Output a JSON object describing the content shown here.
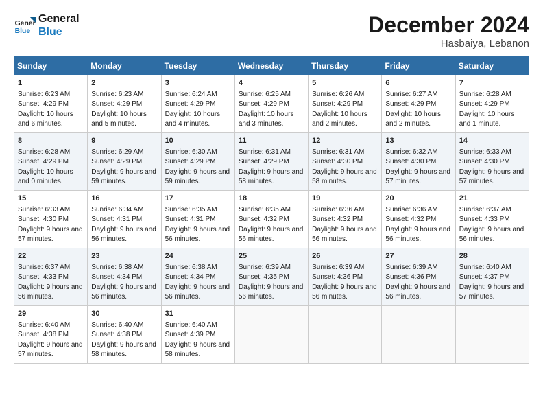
{
  "logo": {
    "line1": "General",
    "line2": "Blue"
  },
  "title": "December 2024",
  "subtitle": "Hasbaiya, Lebanon",
  "days_header": [
    "Sunday",
    "Monday",
    "Tuesday",
    "Wednesday",
    "Thursday",
    "Friday",
    "Saturday"
  ],
  "weeks": [
    [
      {
        "day": "1",
        "sunrise": "6:23 AM",
        "sunset": "4:29 PM",
        "daylight": "10 hours and 6 minutes."
      },
      {
        "day": "2",
        "sunrise": "6:23 AM",
        "sunset": "4:29 PM",
        "daylight": "10 hours and 5 minutes."
      },
      {
        "day": "3",
        "sunrise": "6:24 AM",
        "sunset": "4:29 PM",
        "daylight": "10 hours and 4 minutes."
      },
      {
        "day": "4",
        "sunrise": "6:25 AM",
        "sunset": "4:29 PM",
        "daylight": "10 hours and 3 minutes."
      },
      {
        "day": "5",
        "sunrise": "6:26 AM",
        "sunset": "4:29 PM",
        "daylight": "10 hours and 2 minutes."
      },
      {
        "day": "6",
        "sunrise": "6:27 AM",
        "sunset": "4:29 PM",
        "daylight": "10 hours and 2 minutes."
      },
      {
        "day": "7",
        "sunrise": "6:28 AM",
        "sunset": "4:29 PM",
        "daylight": "10 hours and 1 minute."
      }
    ],
    [
      {
        "day": "8",
        "sunrise": "6:28 AM",
        "sunset": "4:29 PM",
        "daylight": "10 hours and 0 minutes."
      },
      {
        "day": "9",
        "sunrise": "6:29 AM",
        "sunset": "4:29 PM",
        "daylight": "9 hours and 59 minutes."
      },
      {
        "day": "10",
        "sunrise": "6:30 AM",
        "sunset": "4:29 PM",
        "daylight": "9 hours and 59 minutes."
      },
      {
        "day": "11",
        "sunrise": "6:31 AM",
        "sunset": "4:29 PM",
        "daylight": "9 hours and 58 minutes."
      },
      {
        "day": "12",
        "sunrise": "6:31 AM",
        "sunset": "4:30 PM",
        "daylight": "9 hours and 58 minutes."
      },
      {
        "day": "13",
        "sunrise": "6:32 AM",
        "sunset": "4:30 PM",
        "daylight": "9 hours and 57 minutes."
      },
      {
        "day": "14",
        "sunrise": "6:33 AM",
        "sunset": "4:30 PM",
        "daylight": "9 hours and 57 minutes."
      }
    ],
    [
      {
        "day": "15",
        "sunrise": "6:33 AM",
        "sunset": "4:30 PM",
        "daylight": "9 hours and 57 minutes."
      },
      {
        "day": "16",
        "sunrise": "6:34 AM",
        "sunset": "4:31 PM",
        "daylight": "9 hours and 56 minutes."
      },
      {
        "day": "17",
        "sunrise": "6:35 AM",
        "sunset": "4:31 PM",
        "daylight": "9 hours and 56 minutes."
      },
      {
        "day": "18",
        "sunrise": "6:35 AM",
        "sunset": "4:32 PM",
        "daylight": "9 hours and 56 minutes."
      },
      {
        "day": "19",
        "sunrise": "6:36 AM",
        "sunset": "4:32 PM",
        "daylight": "9 hours and 56 minutes."
      },
      {
        "day": "20",
        "sunrise": "6:36 AM",
        "sunset": "4:32 PM",
        "daylight": "9 hours and 56 minutes."
      },
      {
        "day": "21",
        "sunrise": "6:37 AM",
        "sunset": "4:33 PM",
        "daylight": "9 hours and 56 minutes."
      }
    ],
    [
      {
        "day": "22",
        "sunrise": "6:37 AM",
        "sunset": "4:33 PM",
        "daylight": "9 hours and 56 minutes."
      },
      {
        "day": "23",
        "sunrise": "6:38 AM",
        "sunset": "4:34 PM",
        "daylight": "9 hours and 56 minutes."
      },
      {
        "day": "24",
        "sunrise": "6:38 AM",
        "sunset": "4:34 PM",
        "daylight": "9 hours and 56 minutes."
      },
      {
        "day": "25",
        "sunrise": "6:39 AM",
        "sunset": "4:35 PM",
        "daylight": "9 hours and 56 minutes."
      },
      {
        "day": "26",
        "sunrise": "6:39 AM",
        "sunset": "4:36 PM",
        "daylight": "9 hours and 56 minutes."
      },
      {
        "day": "27",
        "sunrise": "6:39 AM",
        "sunset": "4:36 PM",
        "daylight": "9 hours and 56 minutes."
      },
      {
        "day": "28",
        "sunrise": "6:40 AM",
        "sunset": "4:37 PM",
        "daylight": "9 hours and 57 minutes."
      }
    ],
    [
      {
        "day": "29",
        "sunrise": "6:40 AM",
        "sunset": "4:38 PM",
        "daylight": "9 hours and 57 minutes."
      },
      {
        "day": "30",
        "sunrise": "6:40 AM",
        "sunset": "4:38 PM",
        "daylight": "9 hours and 58 minutes."
      },
      {
        "day": "31",
        "sunrise": "6:40 AM",
        "sunset": "4:39 PM",
        "daylight": "9 hours and 58 minutes."
      },
      null,
      null,
      null,
      null
    ]
  ]
}
